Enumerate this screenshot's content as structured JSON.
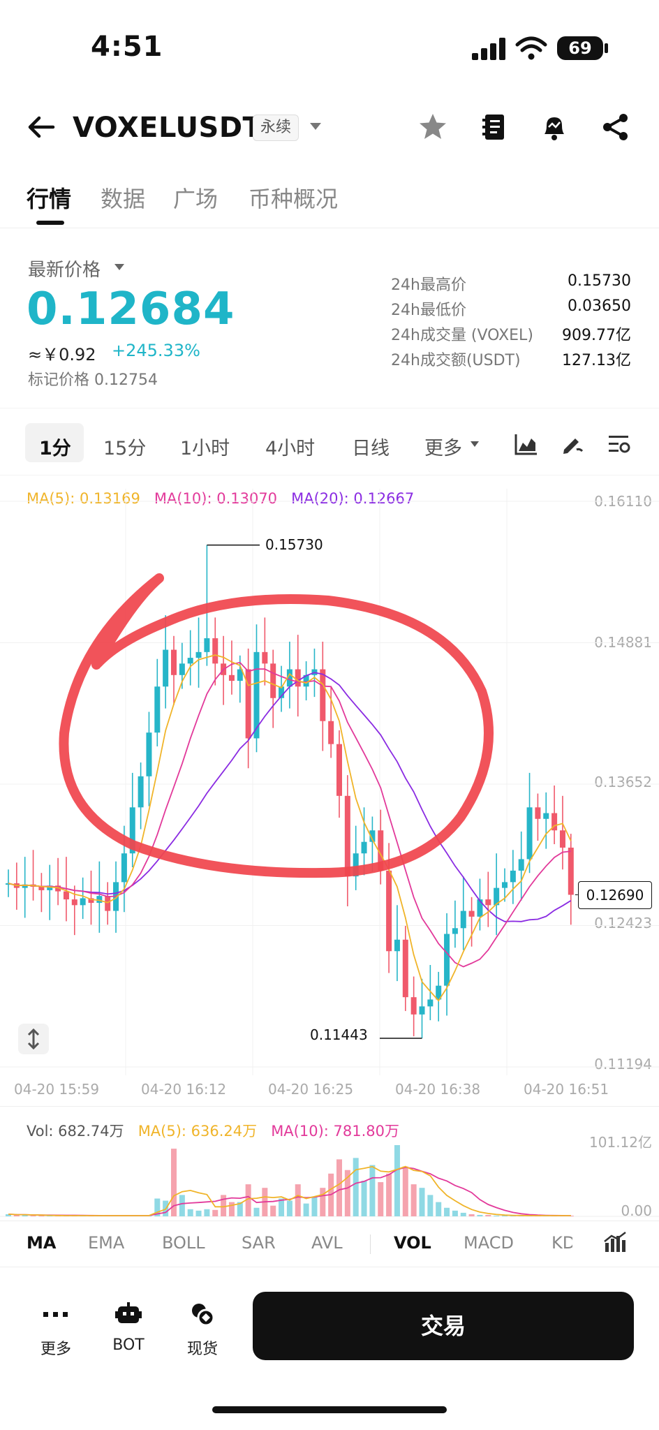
{
  "status_bar": {
    "time": "4:51",
    "battery": "69"
  },
  "header": {
    "symbol": "VOXELUSDT",
    "badge": "永续"
  },
  "tabs": [
    {
      "label": "行情",
      "active": true
    },
    {
      "label": "数据"
    },
    {
      "label": "广场"
    },
    {
      "label": "币种概况"
    }
  ],
  "price": {
    "label": "最新价格",
    "last": "0.12684",
    "cny": "≈￥0.92",
    "change": "+245.33%",
    "mark": "标记价格 0.12754"
  },
  "stats": [
    {
      "label": "24h最高价",
      "value": "0.15730"
    },
    {
      "label": "24h最低价",
      "value": "0.03650"
    },
    {
      "label": "24h成交量 (VOXEL)",
      "value": "909.77亿"
    },
    {
      "label": "24h成交额(USDT)",
      "value": "127.13亿"
    }
  ],
  "intervals": [
    {
      "label": "1分",
      "active": true
    },
    {
      "label": "15分"
    },
    {
      "label": "1小时"
    },
    {
      "label": "4小时"
    },
    {
      "label": "日线"
    },
    {
      "label": "更多"
    }
  ],
  "ma_legend": {
    "ma5": "MA(5): 0.13169",
    "ma10": "MA(10): 0.13070",
    "ma20": "MA(20): 0.12667"
  },
  "colors": {
    "up": "#26b5c8",
    "down": "#f0596b",
    "ma5": "#f0b429",
    "ma10": "#e2399a",
    "ma20": "#8a2be2",
    "annotation": "#f0464e",
    "price_accent": "#1fb5c8"
  },
  "chart_data": {
    "type": "candlestick",
    "y_ticks": [
      "0.16110",
      "0.14881",
      "0.13652",
      "0.12423",
      "0.11194"
    ],
    "ylim": [
      0.11194,
      0.1611
    ],
    "x_ticks": [
      "04-20 15:59",
      "04-20 16:12",
      "04-20 16:25",
      "04-20 16:38",
      "04-20 16:51"
    ],
    "high_label": "0.15730",
    "low_label": "0.11443",
    "current_label": "0.12690",
    "closes": [
      0.1279,
      0.1275,
      0.1278,
      0.1276,
      0.1273,
      0.1277,
      0.1272,
      0.1265,
      0.126,
      0.1266,
      0.1262,
      0.1268,
      0.1255,
      0.128,
      0.1305,
      0.1345,
      0.1372,
      0.141,
      0.145,
      0.1482,
      0.146,
      0.147,
      0.1475,
      0.148,
      0.1492,
      0.147,
      0.146,
      0.1455,
      0.1465,
      0.1405,
      0.148,
      0.147,
      0.144,
      0.145,
      0.1465,
      0.145,
      0.146,
      0.1465,
      0.142,
      0.14,
      0.1355,
      0.1285,
      0.1305,
      0.1315,
      0.1325,
      0.129,
      0.122,
      0.123,
      0.118,
      0.1165,
      0.1172,
      0.1178,
      0.119,
      0.1235,
      0.124,
      0.1255,
      0.125,
      0.1265,
      0.126,
      0.1275,
      0.128,
      0.129,
      0.13,
      0.1345,
      0.1335,
      0.134,
      0.1325,
      0.131,
      0.1269
    ],
    "volume": {
      "legend": "Vol: 682.74万",
      "ma5": "MA(5): 636.24万",
      "ma10": "MA(10): 781.80万",
      "y_ticks": [
        "101.12亿",
        "0.00"
      ],
      "bars": [
        3,
        2,
        2,
        1,
        1,
        1,
        1,
        1,
        1,
        1,
        1,
        1,
        1,
        1,
        1,
        1,
        1,
        1,
        25,
        22,
        95,
        30,
        10,
        8,
        10,
        9,
        30,
        20,
        20,
        45,
        12,
        40,
        15,
        25,
        22,
        45,
        18,
        28,
        40,
        60,
        80,
        65,
        82,
        50,
        72,
        48,
        60,
        100,
        70,
        45,
        40,
        30,
        20,
        12,
        8,
        5,
        3,
        2,
        2,
        1,
        1,
        1,
        1,
        1,
        1,
        1,
        1,
        1,
        1
      ]
    }
  },
  "indicators": {
    "main": [
      "MA",
      "EMA",
      "BOLL",
      "SAR",
      "AVL"
    ],
    "sub": [
      "VOL",
      "MACD",
      "KD"
    ]
  },
  "bottom": {
    "more": "更多",
    "bot": "BOT",
    "spot": "现货",
    "trade": "交易"
  }
}
